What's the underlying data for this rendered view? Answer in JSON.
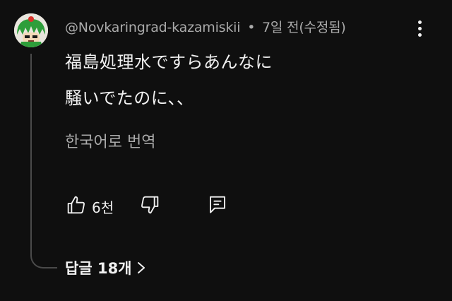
{
  "comment": {
    "author": "@Novkaringrad-kazamiskii",
    "separator": "•",
    "time": "7일 전(수정됨)",
    "body_lines": [
      "福島処理水ですらあんなに",
      "騒いでたのに、、"
    ],
    "translate_label": "한국어로 번역",
    "like_count": "6천",
    "replies_label": "답글 18개"
  },
  "icons": {
    "menu": "more-vertical-icon",
    "like": "thumbs-up-icon",
    "dislike": "thumbs-down-icon",
    "reply": "reply-comment-icon",
    "replies": "chevron-right-icon"
  },
  "colors": {
    "background": "#0f0f0f",
    "primary_text": "#f1f1f1",
    "secondary_text": "#aaaaaa",
    "thread_line": "#4a4a4a"
  }
}
